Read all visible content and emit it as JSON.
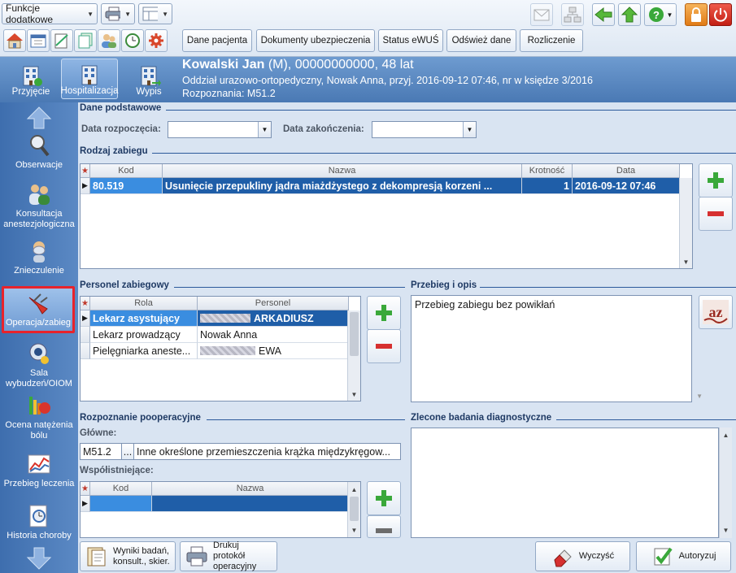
{
  "toolbar": {
    "functions_label": "Funkcje dodatkowe",
    "buttons": [
      "Dane pacjenta",
      "Dokumenty ubezpieczenia",
      "Status eWUŚ",
      "Odśwież dane",
      "Rozliczenie"
    ]
  },
  "header": {
    "modes": [
      "Przyjęcie",
      "Hospitalizacja",
      "Wypis"
    ],
    "patient_name": "Kowalski Jan",
    "patient_details": " (M), 00000000000, 48 lat",
    "line2": "Oddział urazowo-ortopedyczny, Nowak Anna, przyj. 2016-09-12 07:46, nr w księdze 3/2016",
    "line3": "Rozpoznania: M51.2"
  },
  "nav": {
    "items": [
      "Obserwacje",
      "Konsultacja anestezjologiczna",
      "Znieczulenie",
      "Operacja/zabieg",
      "Sala wybudzeń/OIOM",
      "Ocena natężenia bólu",
      "Przebieg leczenia",
      "Historia choroby"
    ]
  },
  "basic": {
    "title": "Dane podstawowe",
    "start_label": "Data rozpoczęcia:",
    "end_label": "Data zakończenia:",
    "start_value": "",
    "end_value": ""
  },
  "procedure": {
    "title": "Rodzaj zabiegu",
    "columns": [
      "Kod",
      "Nazwa",
      "Krotność",
      "Data"
    ],
    "rows": [
      {
        "code": "80.519",
        "name": "Usunięcie przepukliny jądra miażdżystego z dekompresją korzeni ...",
        "multiplicity": "1",
        "date": "2016-09-12 07:46"
      }
    ]
  },
  "staff": {
    "title": "Personel zabiegowy",
    "columns": [
      "Rola",
      "Personel"
    ],
    "rows": [
      {
        "role": "Lekarz asystujący",
        "person": "ARKADIUSZ",
        "blurred": true
      },
      {
        "role": "Lekarz prowadzący",
        "person": "Nowak Anna",
        "blurred": false
      },
      {
        "role": "Pielęgniarka aneste...",
        "person": "EWA",
        "blurred": true
      }
    ]
  },
  "description": {
    "title": "Przebieg i opis",
    "text": "Przebieg zabiegu bez powikłań"
  },
  "diagnosis": {
    "title": "Rozpoznanie pooperacyjne",
    "main_label": "Główne:",
    "main_code": "M51.2",
    "main_name": "Inne określone przemieszczenia krążka międzykręgow...",
    "ellipsis": "...",
    "coexisting_label": "Współistniejące:",
    "columns": [
      "Kod",
      "Nazwa"
    ]
  },
  "tests": {
    "title": "Zlecone badania diagnostyczne",
    "text": ""
  },
  "bottom": {
    "results_label": "Wyniki badań, konsult., skier.",
    "print_label": "Drukuj protokół operacyjny",
    "clear_label": "Wyczyść",
    "authorize_label": "Autoryzuj"
  },
  "colors": {
    "selection": "#1f5ea8",
    "header_blue": "#4a79b4",
    "active_nav_outline": "#e8232b",
    "add_green": "#3aa83a",
    "remove_red": "#d63030"
  }
}
